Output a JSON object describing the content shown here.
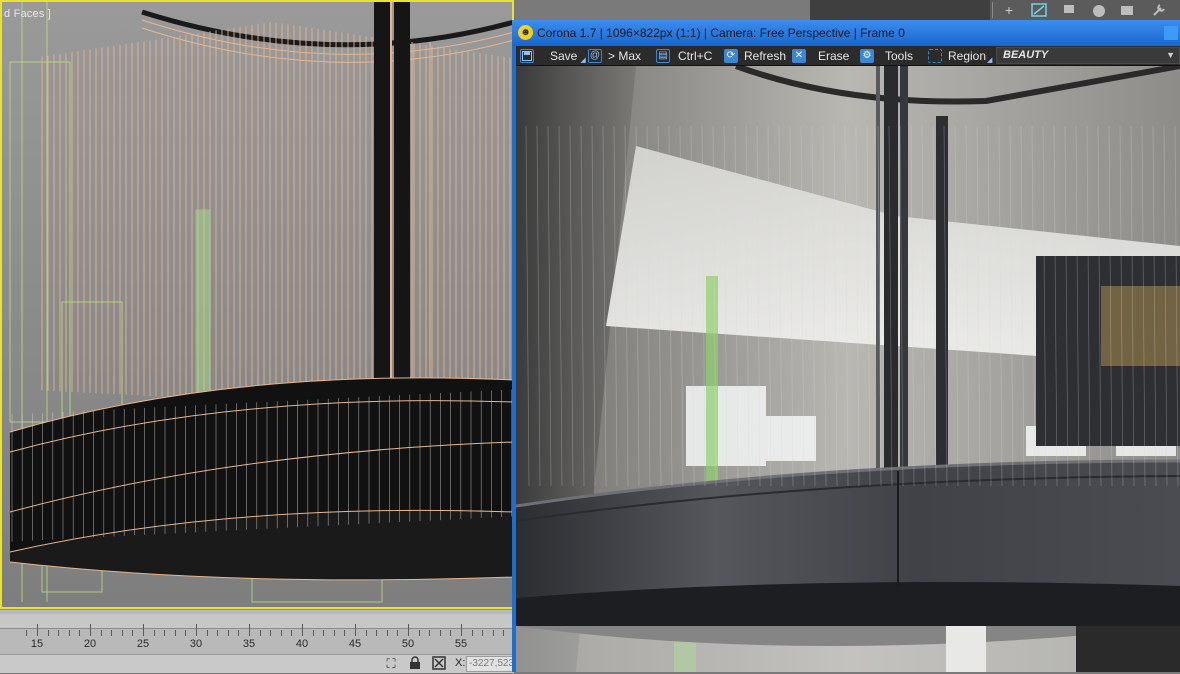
{
  "viewport": {
    "label": "d Faces ]"
  },
  "max_toolbar": {
    "icons": [
      "plus-icon",
      "curve-editor-icon",
      "minus-icon",
      "sphere-icon",
      "rectangle-icon",
      "wrench-icon"
    ]
  },
  "timeslider": {
    "ticks": [
      "15",
      "20",
      "25",
      "30",
      "35",
      "40",
      "45",
      "50",
      "55"
    ]
  },
  "statusbar": {
    "x_label": "X:",
    "x_value": "-3227,523"
  },
  "vfb": {
    "title": "Corona 1.7 | 1096×822px (1:1) | Camera: Free Perspective | Frame 0",
    "toolbar": {
      "save": "Save",
      "max": "> Max",
      "copy": "Ctrl+C",
      "refresh": "Refresh",
      "erase": "Erase",
      "tools": "Tools",
      "region": "Region",
      "channel": "BEAUTY"
    },
    "colors": {
      "title_blue": "#1e6ed1",
      "toolbar_bg": "#2b2b2b",
      "icon_blue": "#3b87d6",
      "viewport_border": "#e8e232"
    }
  }
}
